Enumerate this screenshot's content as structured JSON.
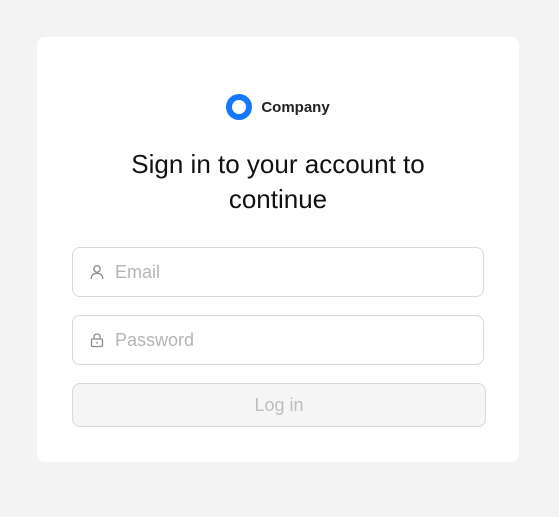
{
  "brand": {
    "name": "Company",
    "logo_icon": "ring-logo-icon",
    "accent_color": "#1677ff"
  },
  "title": "Sign in to your account to continue",
  "form": {
    "email": {
      "placeholder": "Email",
      "value": "",
      "icon": "user-icon"
    },
    "password": {
      "placeholder": "Password",
      "value": "",
      "icon": "lock-icon"
    },
    "login_label": "Log in",
    "login_disabled": true
  }
}
